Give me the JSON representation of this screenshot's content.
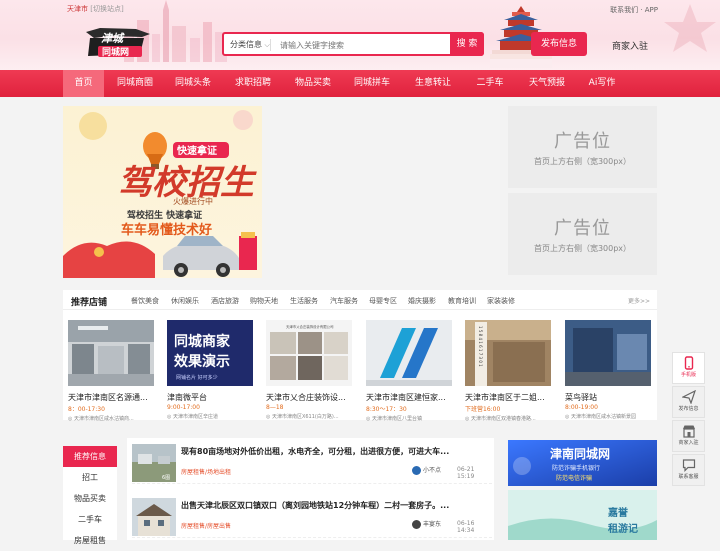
{
  "topbar": {
    "city": "天津市",
    "switch_station": "[切换站点]",
    "right_links": "联系我们 · APP"
  },
  "logo_text": {
    "line1": "津城",
    "line2": "同城网"
  },
  "search": {
    "category": "分类信息",
    "placeholder": "请输入关键字搜索",
    "button": "搜 索"
  },
  "header_actions": {
    "post_info": "发布信息",
    "merchant_join": "商家入驻"
  },
  "nav": {
    "items": [
      "首页",
      "同城商圈",
      "同城头条",
      "求职招聘",
      "物品买卖",
      "同城拼车",
      "生意转让",
      "二手车",
      "天气预报",
      "Ai写作"
    ]
  },
  "main_banner": {
    "badge": "快速拿证",
    "headline": "驾校招生",
    "subline": "火爆进行中",
    "slogan1": "驾校招生 快速拿证",
    "slogan2": "车车易懂技术好"
  },
  "side_ads": [
    {
      "title": "广告位",
      "subtitle": "首页上方右侧（宽300px）"
    },
    {
      "title": "广告位",
      "subtitle": "首页上方右侧（宽300px）"
    }
  ],
  "shops_section": {
    "title": "推荐店铺",
    "categories": [
      "餐饮美食",
      "休闲娱乐",
      "酒店旅游",
      "购物天地",
      "生活服务",
      "汽车服务",
      "母婴专区",
      "婚庆摄影",
      "教育培训",
      "家装装修"
    ],
    "more": "更多>>",
    "shops": [
      {
        "name": "天津市津南区名源通...",
        "hours": "8：00-17:30",
        "address": "天津市津南区咸水沽镇商..."
      },
      {
        "name": "津南微平台",
        "hours": "9:00-17:00",
        "address": "天津市津南区辛庄道"
      },
      {
        "name": "天津市乂合庄装饰设...",
        "hours": "8—18",
        "address": "天津市津南区X611(白万路)..."
      },
      {
        "name": "天津市津南区建恒家...",
        "hours": "8:30～17：30",
        "address": "天津市津南区八里台镇"
      },
      {
        "name": "天津市津南区于二姐...",
        "hours": "下班营16:00",
        "address": "天津市津南区双港镇春港路..."
      },
      {
        "name": "菜鸟驿站",
        "hours": "8:00-19:00",
        "address": "天津市津南区咸水沽镇新景园"
      }
    ],
    "shop_images": {
      "shop2_line1": "同城商家",
      "shop2_line2": "效果演示",
      "shop2_line3": "网铺名片 好可多少",
      "shop3_caption": "天津市乂合庄装饰设计有限公司",
      "shop4_strip": "1 5 8 4 1 6 1 7 3 0 1"
    }
  },
  "sidebar": {
    "items": [
      "推荐信息",
      "招工",
      "物品买卖",
      "二手车",
      "房屋租售"
    ]
  },
  "listings": [
    {
      "title": "现有80亩场地对外低价出租，水电齐全，可分租，出进很方便，可进大车...",
      "tag": "房屋租售/场地出租",
      "user": "小不点",
      "time": "06-21 15:19",
      "photo_count": "6图"
    },
    {
      "title": "出售天津北辰区双口镇双口（离刘园地铁站12分钟车程）二村一套房子。...",
      "tag": "房屋租售/房屋出售",
      "user": "丰宴东",
      "time": "06-16 14:34"
    }
  ],
  "right_promos": [
    {
      "title": "津南同城网",
      "line2": "防范诈骗手机银行",
      "line3": "防范电信诈骗"
    },
    {
      "title": "嘉誉",
      "line2": "租游记"
    }
  ],
  "float_toolbar": {
    "items": [
      {
        "label": "手机版",
        "icon": "phone-icon"
      },
      {
        "label": "发布信息",
        "icon": "send-icon"
      },
      {
        "label": "商家入驻",
        "icon": "store-icon"
      },
      {
        "label": "联系客服",
        "icon": "chat-icon"
      }
    ]
  },
  "colors": {
    "brand": "#e9274f",
    "nav": "#e3243f",
    "accent_orange": "#e26d1f"
  }
}
